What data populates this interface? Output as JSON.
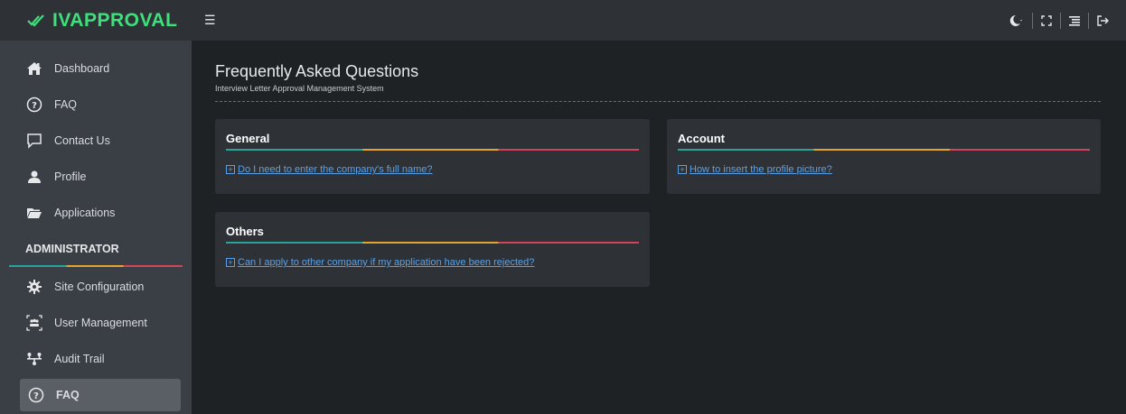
{
  "brand": {
    "name": "IVAPPROVAL",
    "color": "#3ee07c"
  },
  "sidebar": {
    "items": [
      {
        "label": "Dashboard",
        "icon": "home-icon"
      },
      {
        "label": "FAQ",
        "icon": "question-circle-icon"
      },
      {
        "label": "Contact Us",
        "icon": "chat-icon"
      },
      {
        "label": "Profile",
        "icon": "user-icon"
      },
      {
        "label": "Applications",
        "icon": "folder-icon"
      }
    ],
    "section_title": "ADMINISTRATOR",
    "admin_items": [
      {
        "label": "Site Configuration",
        "icon": "cog-icon"
      },
      {
        "label": "User Management",
        "icon": "users-icon"
      },
      {
        "label": "Audit Trail",
        "icon": "sitemap-icon"
      },
      {
        "label": "FAQ",
        "icon": "question-circle-icon",
        "active": true
      }
    ]
  },
  "topbar": {
    "icons": [
      "hamburger-icon",
      "theme-moon-icon",
      "fullscreen-icon",
      "menu-list-icon",
      "logout-icon"
    ]
  },
  "page": {
    "title": "Frequently Asked Questions",
    "subtitle": "Interview Letter Approval Management System"
  },
  "cards": [
    {
      "title": "General",
      "question": "Do I need to enter the company's full name?"
    },
    {
      "title": "Account",
      "question": "How to insert the profile picture?"
    },
    {
      "title": "Others",
      "question": "Can I apply to other company if my application have been rejected?"
    }
  ],
  "colors": {
    "accent_teal": "#2aa39a",
    "accent_amber": "#e2a62f",
    "accent_red": "#d4435b",
    "link": "#5aa0e6"
  }
}
